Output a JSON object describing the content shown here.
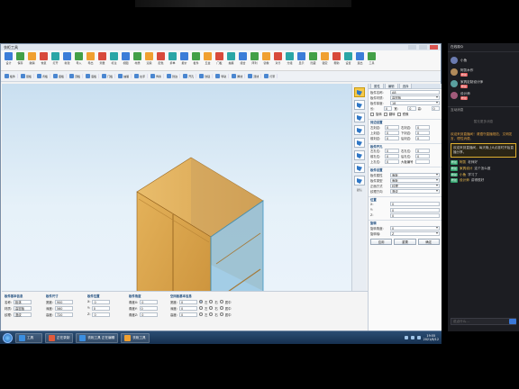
{
  "window": {
    "title": "衣柜工具"
  },
  "ribbon": {
    "buttons": [
      "设计",
      "保存",
      "撤销",
      "恢复",
      "打开",
      "新建",
      "导入",
      "导出",
      "测量",
      "标注",
      "视图",
      "材质",
      "渲染",
      "配色",
      "拆单",
      "报价",
      "板件",
      "五金",
      "门板",
      "抽屉",
      "组合",
      "阵列",
      "镜像",
      "对齐",
      "分组",
      "显示",
      "隐藏",
      "锁定",
      "帮助",
      "设置",
      "退出",
      "工具"
    ],
    "row2": [
      "板件",
      "层板",
      "背板",
      "竖板",
      "顶板",
      "底板",
      "门板",
      "抽屉",
      "拉手",
      "饰条",
      "封边",
      "开孔",
      "铰链",
      "导轨",
      "脚线",
      "顶线",
      "灯带"
    ]
  },
  "toolcol": {
    "label": "默认"
  },
  "props": {
    "header_tabs": [
      "属性",
      "编辑",
      "选择"
    ],
    "rows": [
      {
        "k": "板件名称:",
        "v": "A8"
      },
      {
        "k": "板件材质:",
        "v": "高密板"
      },
      {
        "k": "板件厚度:",
        "v": "18"
      }
    ],
    "xyz": [
      {
        "k": "长:",
        "v": "0"
      },
      {
        "k": "宽:",
        "v": "0"
      },
      {
        "k": "高:",
        "v": "0"
      }
    ],
    "options": [
      "旋转",
      "翻转",
      "镜像"
    ],
    "sec_edge": "封边设置",
    "edges_left": [
      {
        "k": "左封边:",
        "v": "0"
      },
      {
        "k": "上封边:",
        "v": "0"
      },
      {
        "k": "前封边:",
        "v": "0"
      }
    ],
    "edges_right": [
      {
        "k": "右封边:",
        "v": "0"
      },
      {
        "k": "下封边:",
        "v": "0"
      },
      {
        "k": "后封边:",
        "v": "0"
      }
    ],
    "sec_hole": "板件开孔",
    "holes_left": [
      {
        "k": "左孔位:",
        "v": "0"
      },
      {
        "k": "前孔位:",
        "v": "0"
      },
      {
        "k": "上孔位:",
        "v": "0"
      }
    ],
    "holes_right": [
      {
        "k": "右孔位:",
        "v": "0"
      },
      {
        "k": "后孔位:",
        "v": "0"
      },
      {
        "k": "大板编号",
        "v": ""
      }
    ],
    "sec_set": "板件设置",
    "set_rows": [
      {
        "k": "板件属性",
        "v": "面板"
      },
      {
        "k": "板件类型",
        "v": "面板"
      },
      {
        "k": "正面方式",
        "v": "纹理"
      },
      {
        "k": "纹理方向",
        "v": "竖纹"
      }
    ],
    "sec_pos": "位置",
    "pos": [
      {
        "k": "X:",
        "v": "0"
      },
      {
        "k": "Y:",
        "v": "0"
      },
      {
        "k": "Z:",
        "v": "0"
      }
    ],
    "sec_rot": "旋转",
    "rot_rows": [
      {
        "k": "旋转角度:",
        "v": "0"
      },
      {
        "k": "旋转轴:",
        "v": "Z"
      }
    ],
    "buttons": [
      "应用",
      "重置",
      "确定"
    ]
  },
  "bottom": {
    "c1": {
      "hd": "板件基本信息",
      "rows": [
        {
          "k": "名称:",
          "v": "柜体"
        },
        {
          "k": "材质:",
          "v": "高密板"
        },
        {
          "k": "纹理:",
          "v": "竖纹"
        }
      ]
    },
    "c2": {
      "hd": "板件尺寸",
      "rows": [
        {
          "k": "宽度:",
          "v": "900"
        },
        {
          "k": "深度:",
          "v": "560"
        },
        {
          "k": "高度:",
          "v": "720"
        }
      ]
    },
    "c3": {
      "hd": "板件位置",
      "rows": [
        {
          "k": "X:",
          "v": "0"
        },
        {
          "k": "Y:",
          "v": "0"
        },
        {
          "k": "Z:",
          "v": "0"
        }
      ]
    },
    "c4": {
      "hd": "板件角度",
      "rows": [
        {
          "k": "角度X:",
          "v": "0"
        },
        {
          "k": "角度Y:",
          "v": "0"
        },
        {
          "k": "角度Z:",
          "v": "0"
        }
      ]
    },
    "c5": {
      "hd": "空间板基本信息",
      "rows": [
        {
          "k": "宽度:",
          "v": "0"
        },
        {
          "k": "深度:",
          "v": "0"
        },
        {
          "k": "高度:",
          "v": "0"
        }
      ],
      "radio": [
        "左",
        "右",
        "居中"
      ]
    }
  },
  "taskbar": {
    "items": [
      {
        "label": "工具",
        "icon": "b"
      },
      {
        "label": "正在录制",
        "icon": "r"
      },
      {
        "label": "衣柜工具 正在编辑",
        "icon": "b"
      },
      {
        "label": "衣柜工具",
        "icon": "o"
      }
    ],
    "time": "19:55",
    "date": "2021/8/12"
  },
  "chat": {
    "title": "在线观众",
    "users": [
      {
        "name": "小鱼",
        "badge": "",
        "av": "a"
      },
      {
        "name": "阿凯木作",
        "badge": "粉丝",
        "av": "b"
      },
      {
        "name": "家具定制设计师",
        "badge": "粉丝",
        "av": "c"
      },
      {
        "name": "设计师",
        "badge": "粉丝",
        "av": "d"
      }
    ],
    "section": "互动消息",
    "empty": "暂无更多消息",
    "notice": "欢迎来到直播间！请遵守直播规范，文明发言，理性消费。",
    "box": "欢迎来到直播间，每天晚上8点准时开始直播分享。",
    "msgs": [
      {
        "tag": "粉丝",
        "name": "阿凯",
        "text": "老师好"
      },
      {
        "tag": "粉丝",
        "name": "家具设计",
        "text": "这个怎么做"
      },
      {
        "tag": "粉丝",
        "name": "小鱼",
        "text": "学习了"
      },
      {
        "tag": "粉丝",
        "name": "设计师",
        "text": "讲得很好"
      }
    ],
    "input_placeholder": "说点什么..."
  },
  "colors": {
    "accent": "#3b7dd8",
    "wood": "#d9a64e",
    "glass": "#7fb6d8"
  }
}
